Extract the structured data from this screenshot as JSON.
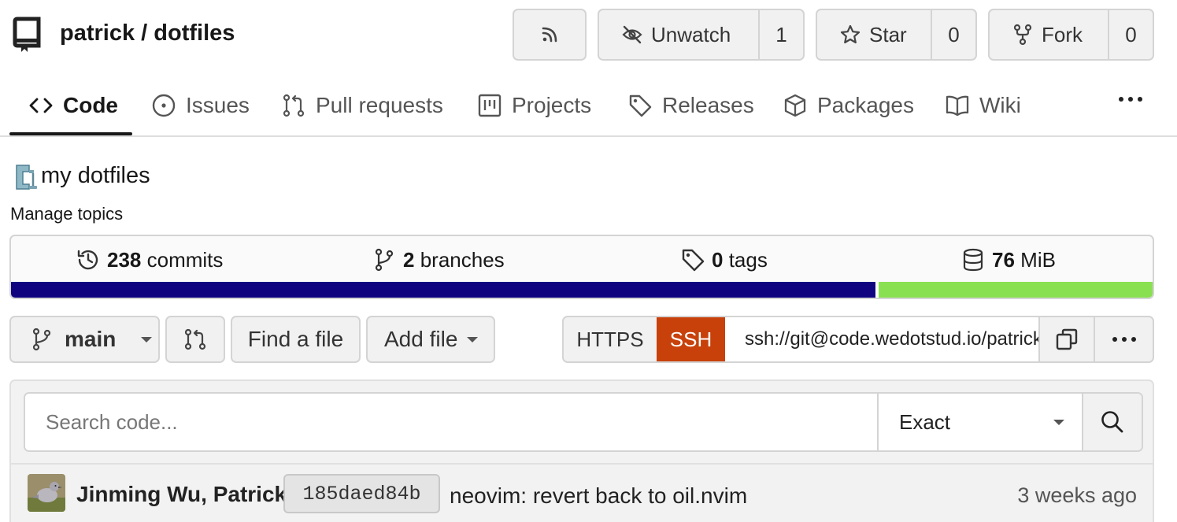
{
  "header": {
    "owner": "patrick",
    "separator": " / ",
    "repo": "dotfiles",
    "buttons": {
      "rss_icon": "rss-icon",
      "watch_label": "Unwatch",
      "watch_count": "1",
      "star_label": "Star",
      "star_count": "0",
      "fork_label": "Fork",
      "fork_count": "0"
    }
  },
  "tabs": [
    {
      "label": "Code",
      "icon": "code-icon",
      "active": true
    },
    {
      "label": "Issues",
      "icon": "issue-icon"
    },
    {
      "label": "Pull requests",
      "icon": "pull-request-icon"
    },
    {
      "label": "Projects",
      "icon": "project-icon"
    },
    {
      "label": "Releases",
      "icon": "tag-icon"
    },
    {
      "label": "Packages",
      "icon": "package-icon"
    },
    {
      "label": "Wiki",
      "icon": "book-icon"
    }
  ],
  "description": {
    "text": "my dotfiles",
    "emoji": "clamp-emoji",
    "manage_topics": "Manage topics"
  },
  "stats": {
    "commits_count": "238",
    "commits_label": "commits",
    "branches_count": "2",
    "branches_label": "branches",
    "tags_count": "0",
    "tags_label": "tags",
    "size_value": "76",
    "size_unit": "MiB",
    "language_bar": [
      {
        "share": 0.757,
        "color": "#0f0380"
      },
      {
        "share": 0.243,
        "color": "#89e051"
      }
    ]
  },
  "toolbar": {
    "branch": "main",
    "find_file": "Find a file",
    "add_file": "Add file",
    "clone": {
      "https_label": "HTTPS",
      "ssh_label": "SSH",
      "url": "ssh://git@code.wedotstud.io/patrick/dotfiles.git",
      "active_color": "#c8410b"
    }
  },
  "search": {
    "placeholder": "Search code...",
    "mode": "Exact"
  },
  "latest_commit": {
    "authors": "Jinming Wu, Patrick",
    "sha": "185daed84b",
    "message": "neovim: revert back to oil.nvim",
    "time": "3 weeks ago"
  }
}
